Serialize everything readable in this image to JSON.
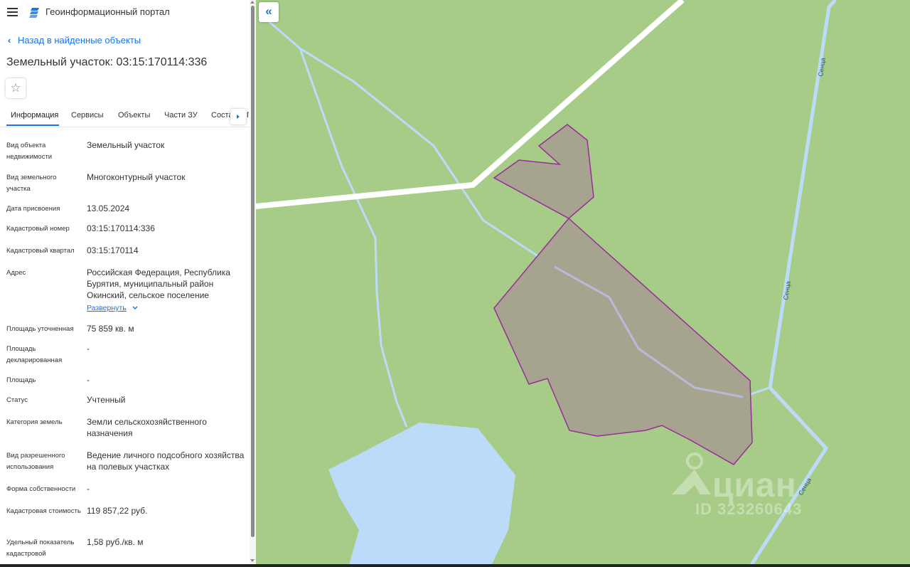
{
  "header": {
    "title": "Геоинформационный портал"
  },
  "back_link": "Назад в найденные объекты",
  "parcel": {
    "title": "Земельный участок: 03:15:170114:336"
  },
  "tabs": [
    {
      "label": "Информация",
      "active": true
    },
    {
      "label": "Сервисы"
    },
    {
      "label": "Объекты"
    },
    {
      "label": "Части ЗУ"
    },
    {
      "label": "Соста"
    },
    {
      "label": "П"
    }
  ],
  "properties": [
    {
      "label": "Вид объекта недвижимости",
      "value": "Земельный участок"
    },
    {
      "label": "Вид земельного участка",
      "value": "Многоконтурный участок"
    },
    {
      "label": "Дата присвоения",
      "value": "13.05.2024"
    },
    {
      "label": "Кадастровый номер",
      "value": "03:15:170114:336"
    },
    {
      "label": "Кадастровый квартал",
      "value": "03:15:170114"
    },
    {
      "label": "Адрес",
      "value": "Российская Федерация, Республика Бурятия, муниципальный район Окинский, сельское поселение"
    },
    {
      "label": "Площадь уточненная",
      "value": "75 859 кв. м"
    },
    {
      "label": "Площадь декларированная",
      "value": "-"
    },
    {
      "label": "Площадь",
      "value": "-"
    },
    {
      "label": "Статус",
      "value": "Учтенный"
    },
    {
      "label": "Категория земель",
      "value": "Земли сельскохозяйственного назначения"
    },
    {
      "label": "Вид разрешенного использования",
      "value": "Ведение личного подсобного хозяйства на полевых участках"
    },
    {
      "label": "Форма собственности",
      "value": "-"
    },
    {
      "label": "Кадастровая стоимость",
      "value": "119 857,22 руб."
    },
    {
      "label": "Удельный показатель кадастровой",
      "value": "1,58 руб./кв. м"
    }
  ],
  "expand_label": "Развернуть",
  "map": {
    "river_label": "Сенца",
    "watermark": {
      "logo": "циан",
      "id": "ID 323260643"
    },
    "colors": {
      "land": "#a6cc88",
      "water": "#bcdbf9",
      "road": "#ffffff",
      "parcel_fill": "#a6a48f",
      "parcel_border": "#9b2b9b"
    }
  },
  "icons": {
    "menu": "menu-icon",
    "logo": "portal-logo-icon",
    "back": "chevron-left-icon",
    "favorite": "star-icon",
    "collapse": "double-chevron-left-icon"
  }
}
